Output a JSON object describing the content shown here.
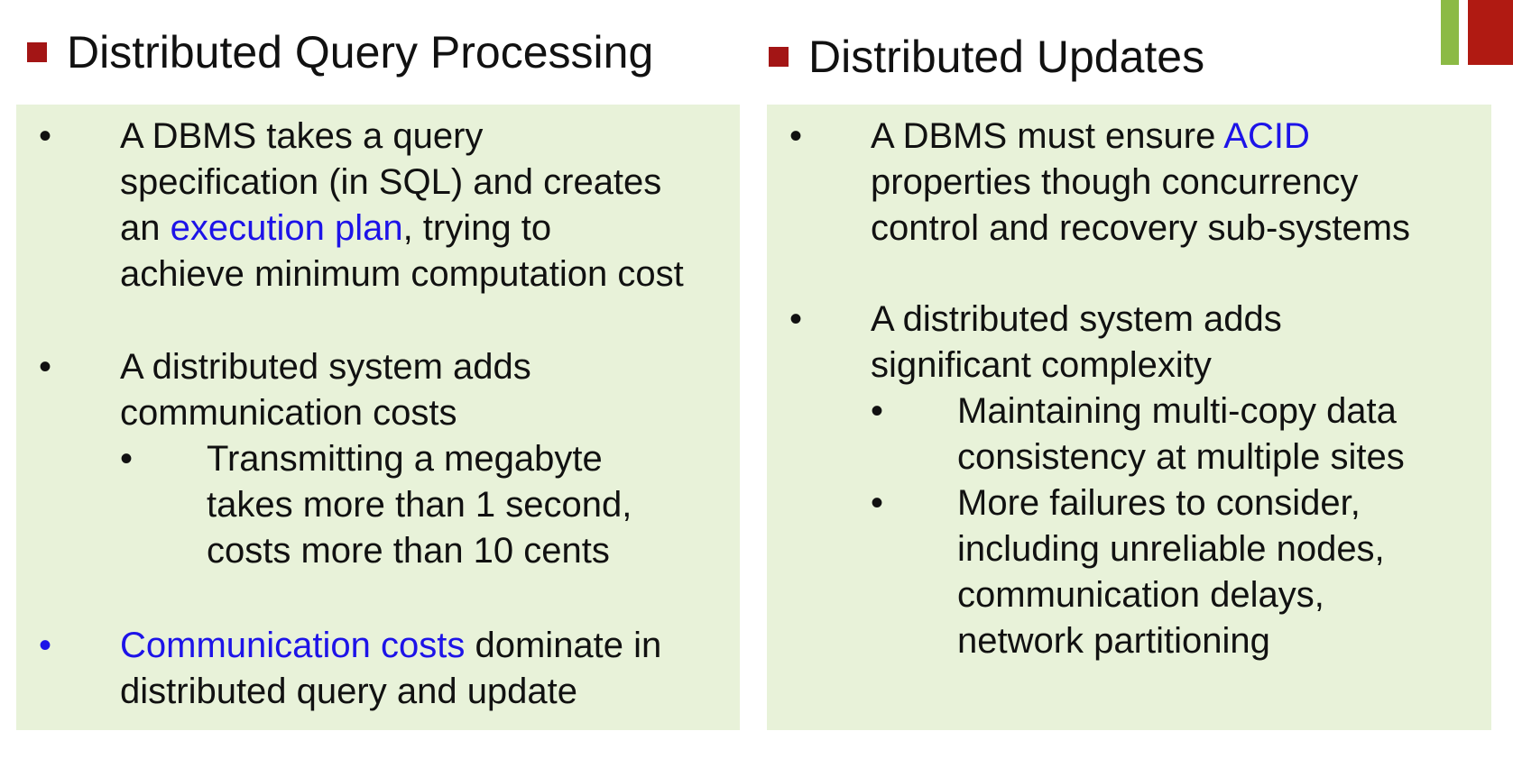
{
  "colors": {
    "accent_green": "#8cba45",
    "accent_red": "#b01a12",
    "title_square": "#a31515",
    "panel_bg": "#e8f2d9",
    "highlight": "#1d13e8"
  },
  "left": {
    "title": "Distributed Query Processing",
    "items": [
      {
        "bullet": "•",
        "lines": [
          {
            "text": "A DBMS takes a query"
          },
          {
            "text": "specification (in SQL) and creates"
          },
          {
            "pre": "an ",
            "hl": "execution plan",
            "post": ", trying to"
          },
          {
            "text": "achieve minimum computation cost"
          }
        ]
      },
      {
        "bullet": "•",
        "lines": [
          {
            "text": "A distributed system adds"
          },
          {
            "text": "communication costs"
          }
        ],
        "sub": [
          {
            "bullet": "•",
            "lines": [
              {
                "text": "Transmitting a megabyte"
              },
              {
                "text": "takes more than 1 second,"
              },
              {
                "text": "costs more than 10 cents"
              }
            ]
          }
        ]
      },
      {
        "bullet": "•",
        "lines": [
          {
            "hl": "Communication costs",
            "post": " dominate in"
          },
          {
            "text": "distributed query and update"
          }
        ]
      }
    ]
  },
  "right": {
    "title": "Distributed Updates",
    "items": [
      {
        "bullet": "•",
        "lines": [
          {
            "pre": "A DBMS must ensure ",
            "hl": "ACID"
          },
          {
            "text": "properties though concurrency"
          },
          {
            "text": "control and recovery sub-systems"
          }
        ]
      },
      {
        "bullet": "•",
        "lines": [
          {
            "text": "A distributed system adds"
          },
          {
            "text": "significant complexity"
          }
        ],
        "sub": [
          {
            "bullet": "•",
            "lines": [
              {
                "text": "Maintaining multi-copy data"
              },
              {
                "text": "consistency at multiple sites"
              }
            ]
          },
          {
            "bullet": "•",
            "lines": [
              {
                "text": "More failures to consider,"
              },
              {
                "text": "including unreliable nodes,"
              },
              {
                "text": "communication delays,"
              },
              {
                "text": "network partitioning"
              }
            ]
          }
        ]
      }
    ]
  }
}
